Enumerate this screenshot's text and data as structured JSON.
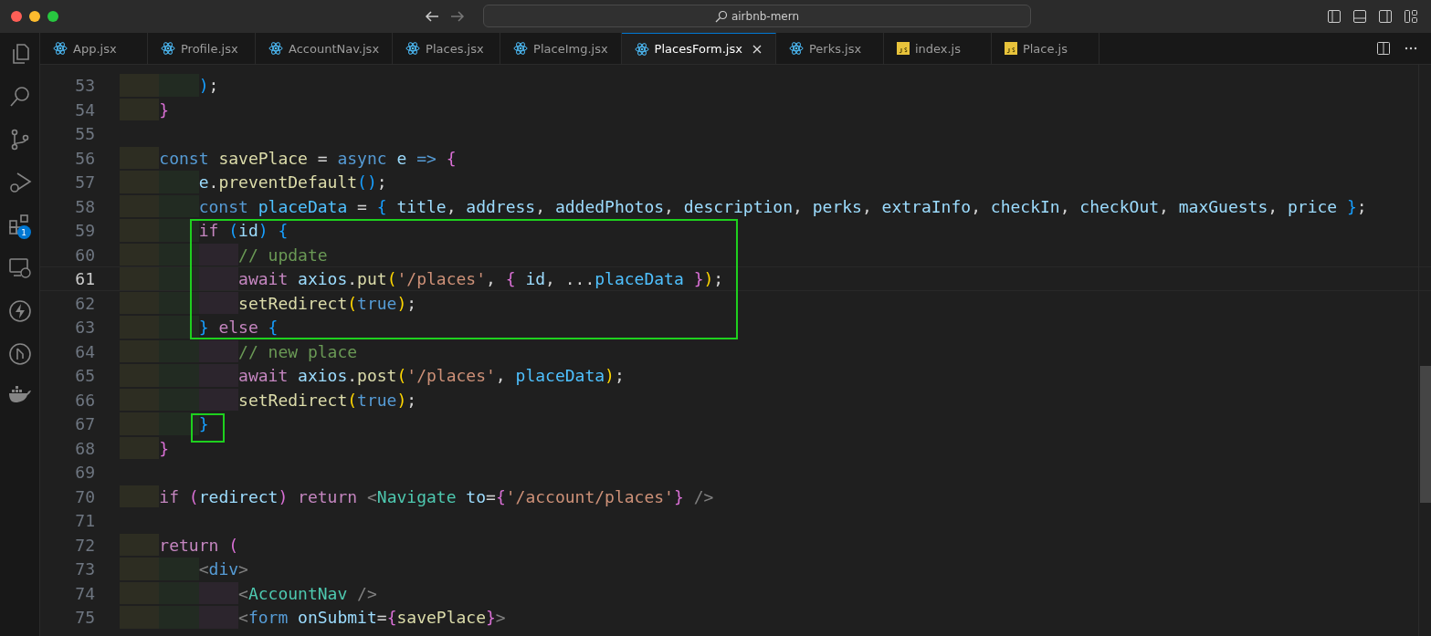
{
  "window": {
    "title": "airbnb-mern"
  },
  "activity_bar": {
    "extensions_badge": "1"
  },
  "tabs": [
    {
      "label": "App.jsx",
      "kind": "react",
      "selected": false
    },
    {
      "label": "Profile.jsx",
      "kind": "react",
      "selected": false
    },
    {
      "label": "AccountNav.jsx",
      "kind": "react",
      "selected": false
    },
    {
      "label": "Places.jsx",
      "kind": "react",
      "selected": false
    },
    {
      "label": "PlaceImg.jsx",
      "kind": "react",
      "selected": false
    },
    {
      "label": "PlacesForm.jsx",
      "kind": "react",
      "selected": true
    },
    {
      "label": "Perks.jsx",
      "kind": "react",
      "selected": false
    },
    {
      "label": "index.js",
      "kind": "js",
      "selected": false
    },
    {
      "label": "Place.js",
      "kind": "js",
      "selected": false
    }
  ],
  "editor": {
    "lines": [
      {
        "number": "53",
        "current": false,
        "tokens": [
          {
            "kind": "b3",
            "text": "        )"
          },
          {
            "kind": "p",
            "text": ";"
          }
        ]
      },
      {
        "number": "54",
        "current": false,
        "tokens": [
          {
            "kind": "b2",
            "text": "    }"
          }
        ]
      },
      {
        "number": "55",
        "current": false
      },
      {
        "number": "56",
        "current": false,
        "tokens": [
          {
            "kind": "kw",
            "text": "    const "
          },
          {
            "kind": "fn",
            "text": "savePlace"
          },
          {
            "kind": "p",
            "text": " = "
          },
          {
            "kind": "kw",
            "text": "async "
          },
          {
            "kind": "var",
            "text": "e "
          },
          {
            "kind": "kw",
            "text": "=> "
          },
          {
            "kind": "b2",
            "text": "{"
          }
        ]
      },
      {
        "number": "57",
        "current": false,
        "tokens": [
          {
            "kind": "var",
            "text": "        e"
          },
          {
            "kind": "p",
            "text": "."
          },
          {
            "kind": "fn",
            "text": "preventDefault"
          },
          {
            "kind": "b3",
            "text": "()"
          },
          {
            "kind": "p",
            "text": ";"
          }
        ]
      },
      {
        "number": "58",
        "current": false,
        "tokens": [
          {
            "kind": "kw",
            "text": "        const "
          },
          {
            "kind": "cvar",
            "text": "placeData"
          },
          {
            "kind": "p",
            "text": " = "
          },
          {
            "kind": "b3",
            "text": "{ "
          },
          {
            "kind": "var",
            "text": "title"
          },
          {
            "kind": "p",
            "text": ", "
          },
          {
            "kind": "var",
            "text": "address"
          },
          {
            "kind": "p",
            "text": ", "
          },
          {
            "kind": "var",
            "text": "addedPhotos"
          },
          {
            "kind": "p",
            "text": ", "
          },
          {
            "kind": "var",
            "text": "description"
          },
          {
            "kind": "p",
            "text": ", "
          },
          {
            "kind": "var",
            "text": "perks"
          },
          {
            "kind": "p",
            "text": ", "
          },
          {
            "kind": "var",
            "text": "extraInfo"
          },
          {
            "kind": "p",
            "text": ", "
          },
          {
            "kind": "var",
            "text": "checkIn"
          },
          {
            "kind": "p",
            "text": ", "
          },
          {
            "kind": "var",
            "text": "checkOut"
          },
          {
            "kind": "p",
            "text": ", "
          },
          {
            "kind": "var",
            "text": "maxGuests"
          },
          {
            "kind": "p",
            "text": ", "
          },
          {
            "kind": "var",
            "text": "price "
          },
          {
            "kind": "b3",
            "text": "}"
          },
          {
            "kind": "p",
            "text": ";"
          }
        ]
      },
      {
        "number": "59",
        "current": false,
        "tokens": [
          {
            "kind": "ctl",
            "text": "        if "
          },
          {
            "kind": "b3",
            "text": "("
          },
          {
            "kind": "var",
            "text": "id"
          },
          {
            "kind": "b3",
            "text": ") {"
          }
        ]
      },
      {
        "number": "60",
        "current": false,
        "tokens": [
          {
            "kind": "cmt",
            "text": "            // update"
          }
        ]
      },
      {
        "number": "61",
        "current": true,
        "tokens": [
          {
            "kind": "ctl",
            "text": "            await "
          },
          {
            "kind": "var",
            "text": "axios"
          },
          {
            "kind": "p",
            "text": "."
          },
          {
            "kind": "fn",
            "text": "put"
          },
          {
            "kind": "b1",
            "text": "("
          },
          {
            "kind": "str",
            "text": "'/places'"
          },
          {
            "kind": "p",
            "text": ", "
          },
          {
            "kind": "b2",
            "text": "{ "
          },
          {
            "kind": "var",
            "text": "id"
          },
          {
            "kind": "p",
            "text": ", ..."
          },
          {
            "kind": "cvar",
            "text": "placeData "
          },
          {
            "kind": "b2",
            "text": "}"
          },
          {
            "kind": "b1",
            "text": ")"
          },
          {
            "kind": "p",
            "text": ";"
          }
        ]
      },
      {
        "number": "62",
        "current": false,
        "tokens": [
          {
            "kind": "fn",
            "text": "            setRedirect"
          },
          {
            "kind": "b1",
            "text": "("
          },
          {
            "kind": "kw",
            "text": "true"
          },
          {
            "kind": "b1",
            "text": ")"
          },
          {
            "kind": "p",
            "text": ";"
          }
        ]
      },
      {
        "number": "63",
        "current": false,
        "tokens": [
          {
            "kind": "b3",
            "text": "        } "
          },
          {
            "kind": "ctl",
            "text": "else "
          },
          {
            "kind": "b3",
            "text": "{"
          }
        ]
      },
      {
        "number": "64",
        "current": false,
        "tokens": [
          {
            "kind": "cmt",
            "text": "            // new place"
          }
        ]
      },
      {
        "number": "65",
        "current": false,
        "tokens": [
          {
            "kind": "ctl",
            "text": "            await "
          },
          {
            "kind": "var",
            "text": "axios"
          },
          {
            "kind": "p",
            "text": "."
          },
          {
            "kind": "fn",
            "text": "post"
          },
          {
            "kind": "b1",
            "text": "("
          },
          {
            "kind": "str",
            "text": "'/places'"
          },
          {
            "kind": "p",
            "text": ", "
          },
          {
            "kind": "cvar",
            "text": "placeData"
          },
          {
            "kind": "b1",
            "text": ")"
          },
          {
            "kind": "p",
            "text": ";"
          }
        ]
      },
      {
        "number": "66",
        "current": false,
        "tokens": [
          {
            "kind": "fn",
            "text": "            setRedirect"
          },
          {
            "kind": "b1",
            "text": "("
          },
          {
            "kind": "kw",
            "text": "true"
          },
          {
            "kind": "b1",
            "text": ")"
          },
          {
            "kind": "p",
            "text": ";"
          }
        ]
      },
      {
        "number": "67",
        "current": false,
        "tokens": [
          {
            "kind": "b3",
            "text": "        }"
          }
        ]
      },
      {
        "number": "68",
        "current": false,
        "tokens": [
          {
            "kind": "b2",
            "text": "    }"
          }
        ]
      },
      {
        "number": "69",
        "current": false
      },
      {
        "number": "70",
        "current": false,
        "tokens": [
          {
            "kind": "ctl",
            "text": "    if "
          },
          {
            "kind": "b2",
            "text": "("
          },
          {
            "kind": "var",
            "text": "redirect"
          },
          {
            "kind": "b2",
            "text": ") "
          },
          {
            "kind": "ctl",
            "text": "return "
          },
          {
            "kind": "tag",
            "text": "<"
          },
          {
            "kind": "comp",
            "text": "Navigate "
          },
          {
            "kind": "var",
            "text": "to"
          },
          {
            "kind": "p",
            "text": "="
          },
          {
            "kind": "b2",
            "text": "{"
          },
          {
            "kind": "str",
            "text": "'/account/places'"
          },
          {
            "kind": "b2",
            "text": "} "
          },
          {
            "kind": "tag",
            "text": "/>"
          }
        ]
      },
      {
        "number": "71",
        "current": false
      },
      {
        "number": "72",
        "current": false,
        "tokens": [
          {
            "kind": "ctl",
            "text": "    return "
          },
          {
            "kind": "b2",
            "text": "("
          }
        ]
      },
      {
        "number": "73",
        "current": false,
        "tokens": [
          {
            "kind": "tag",
            "text": "        <"
          },
          {
            "kind": "kw",
            "text": "div"
          },
          {
            "kind": "tag",
            "text": ">"
          }
        ]
      },
      {
        "number": "74",
        "current": false,
        "tokens": [
          {
            "kind": "tag",
            "text": "            <"
          },
          {
            "kind": "comp",
            "text": "AccountNav "
          },
          {
            "kind": "tag",
            "text": "/>"
          }
        ]
      },
      {
        "number": "75",
        "current": false,
        "tokens": [
          {
            "kind": "tag",
            "text": "            <"
          },
          {
            "kind": "kw",
            "text": "form "
          },
          {
            "kind": "var",
            "text": "onSubmit"
          },
          {
            "kind": "p",
            "text": "="
          },
          {
            "kind": "b2",
            "text": "{"
          },
          {
            "kind": "fn",
            "text": "savePlace"
          },
          {
            "kind": "b2",
            "text": "}"
          },
          {
            "kind": "tag",
            "text": ">"
          }
        ]
      }
    ]
  }
}
